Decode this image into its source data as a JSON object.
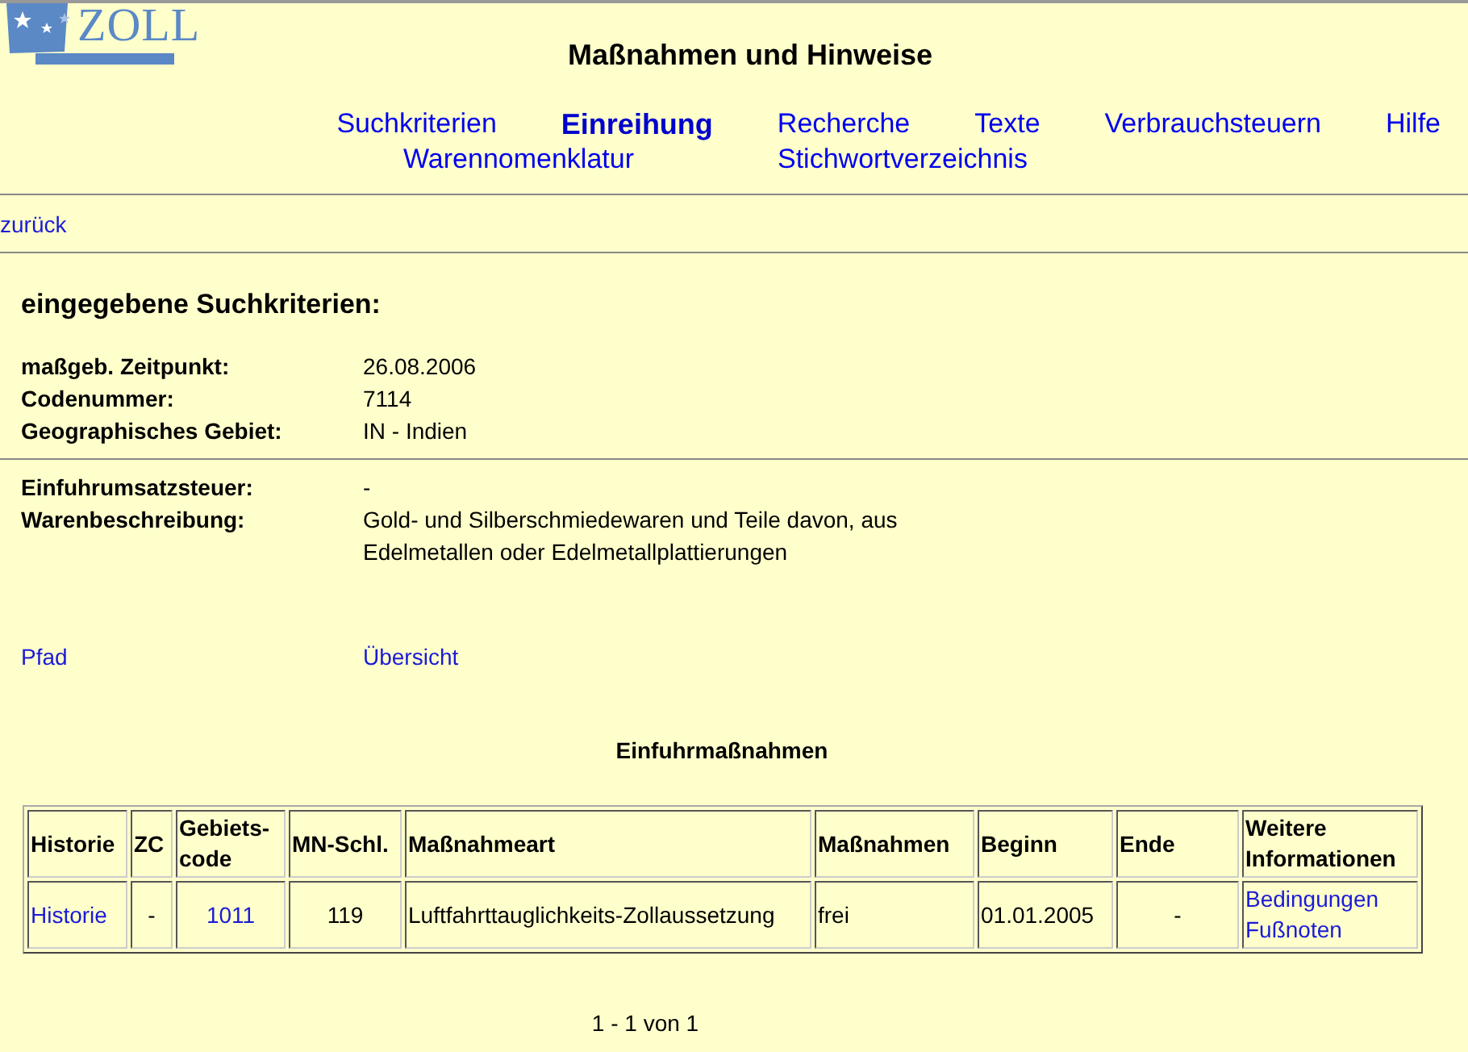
{
  "logo": {
    "text": "ZOLL"
  },
  "title": "Maßnahmen und Hinweise",
  "nav": [
    [
      {
        "label": "Suchkriterien",
        "selected": false
      },
      {
        "label": "Einreihung",
        "selected": true
      },
      {
        "label": "Recherche",
        "selected": false
      },
      {
        "label": "Texte",
        "selected": false
      },
      {
        "label": "Verbrauchsteuern",
        "selected": false
      },
      {
        "label": "Hilfe",
        "selected": false
      }
    ],
    [
      {
        "label": "Warennomenklatur",
        "selected": false
      },
      {
        "label": "Stichwortverzeichnis",
        "selected": false
      }
    ]
  ],
  "back_link": "zurück",
  "criteria": {
    "heading": "eingegebene Suchkriterien:",
    "groups": [
      [
        {
          "label": "maßgeb. Zeitpunkt:",
          "value": "26.08.2006"
        },
        {
          "label": "Codenummer:",
          "value": "7114"
        },
        {
          "label": "Geographisches Gebiet:",
          "value": "IN - Indien"
        }
      ],
      [
        {
          "label": "Einfuhrumsatzsteuer:",
          "value": "-"
        },
        {
          "label": "Warenbeschreibung:",
          "value": "Gold- und Silberschmiedewaren und Teile davon, aus Edelmetallen oder Edelmetallplattierungen"
        }
      ]
    ]
  },
  "links": [
    "Pfad",
    "Übersicht"
  ],
  "table": {
    "caption": "Einfuhrmaßnahmen",
    "columns": [
      "Historie",
      "ZC",
      "Gebiets-code",
      "MN-Schl.",
      "Maßnahmeart",
      "Maßnahmen",
      "Beginn",
      "Ende",
      "Weitere Informationen"
    ],
    "rows": [
      [
        {
          "lines": [
            "Historie"
          ],
          "link": true
        },
        {
          "lines": [
            "-"
          ],
          "link": false
        },
        {
          "lines": [
            "1011"
          ],
          "link": true
        },
        {
          "lines": [
            "119"
          ],
          "link": false
        },
        {
          "lines": [
            "Luftfahrttauglichkeits-Zollaussetzung"
          ],
          "link": false
        },
        {
          "lines": [
            "frei"
          ],
          "link": false
        },
        {
          "lines": [
            "01.01.2005"
          ],
          "link": false
        },
        {
          "lines": [
            "-"
          ],
          "link": false
        },
        {
          "lines": [
            "Bedingungen",
            "Fußnoten"
          ],
          "link": true
        }
      ]
    ]
  },
  "pager": "1 - 1 von 1"
}
